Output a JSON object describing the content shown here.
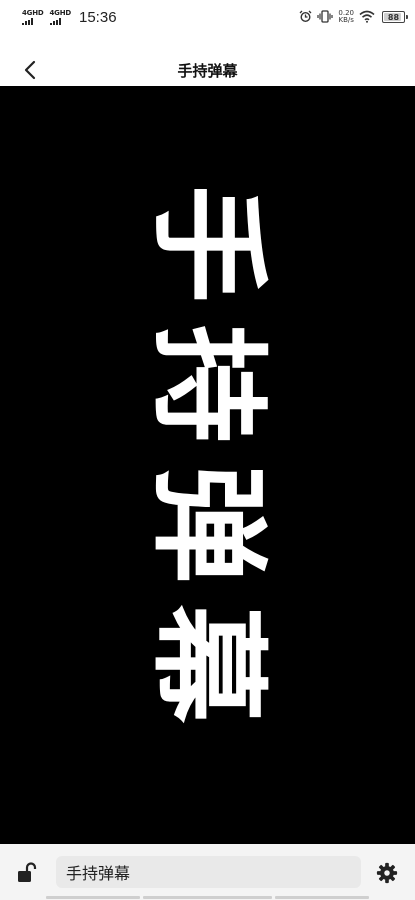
{
  "status_bar": {
    "network_1": "4GHD",
    "network_2": "4GHD",
    "time": "15:36",
    "speed_value": "0.20",
    "speed_unit": "KB/s",
    "battery": "88",
    "battery_level": 0.88,
    "icons": [
      "alarm-icon",
      "vibrate-icon",
      "wifi-icon",
      "battery-icon"
    ]
  },
  "header": {
    "title": "手持弹幕",
    "back_icon": "chevron-left-icon"
  },
  "display": {
    "text": "手持弹幕",
    "text_color": "#ffffff",
    "background_color": "#000000"
  },
  "bottom_bar": {
    "input_value": "手持弹幕",
    "lock_icon": "unlock-icon",
    "settings_icon": "gear-icon"
  }
}
